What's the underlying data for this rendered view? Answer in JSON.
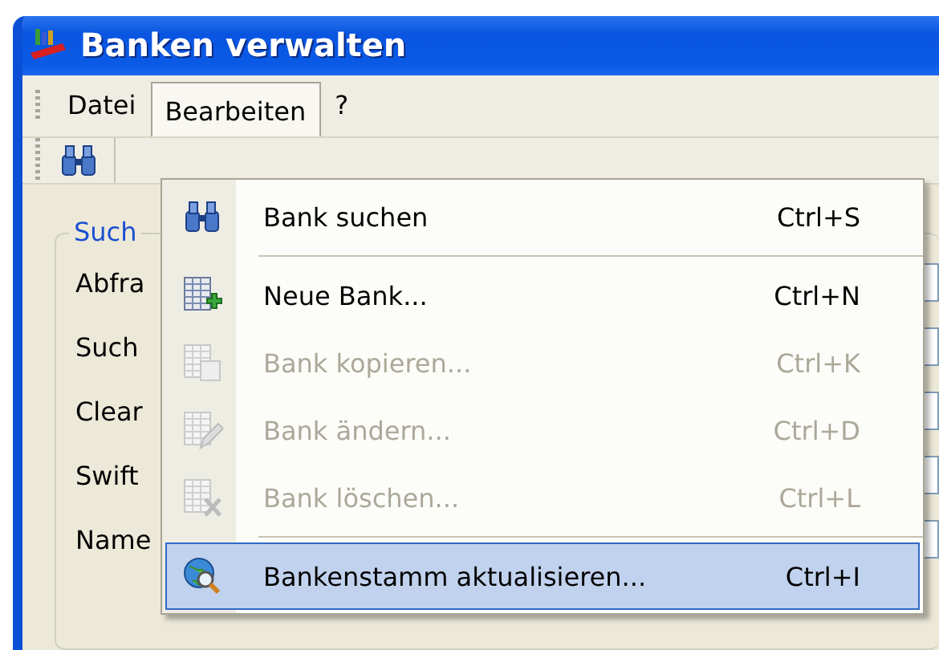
{
  "window": {
    "title": "Banken verwalten"
  },
  "menubar": [
    {
      "label": "Datei",
      "selected": false
    },
    {
      "label": "Bearbeiten",
      "selected": true
    },
    {
      "label": "?",
      "selected": false
    }
  ],
  "search_group": {
    "title": "Such",
    "labels": [
      "Abfra",
      "Such",
      "Clear",
      "Swift",
      "Name"
    ]
  },
  "menu": [
    {
      "kind": "item",
      "label": "Bank suchen",
      "shortcut": "Ctrl+S",
      "disabled": false,
      "selected": false
    },
    {
      "kind": "separator"
    },
    {
      "kind": "item",
      "label": "Neue Bank...",
      "shortcut": "Ctrl+N",
      "disabled": false,
      "selected": false
    },
    {
      "kind": "item",
      "label": "Bank kopieren...",
      "shortcut": "Ctrl+K",
      "disabled": true,
      "selected": false
    },
    {
      "kind": "item",
      "label": "Bank ändern...",
      "shortcut": "Ctrl+D",
      "disabled": true,
      "selected": false
    },
    {
      "kind": "item",
      "label": "Bank löschen...",
      "shortcut": "Ctrl+L",
      "disabled": true,
      "selected": false
    },
    {
      "kind": "separator"
    },
    {
      "kind": "item",
      "label": "Bankenstamm aktualisieren...",
      "shortcut": "Ctrl+I",
      "disabled": false,
      "selected": true
    }
  ]
}
